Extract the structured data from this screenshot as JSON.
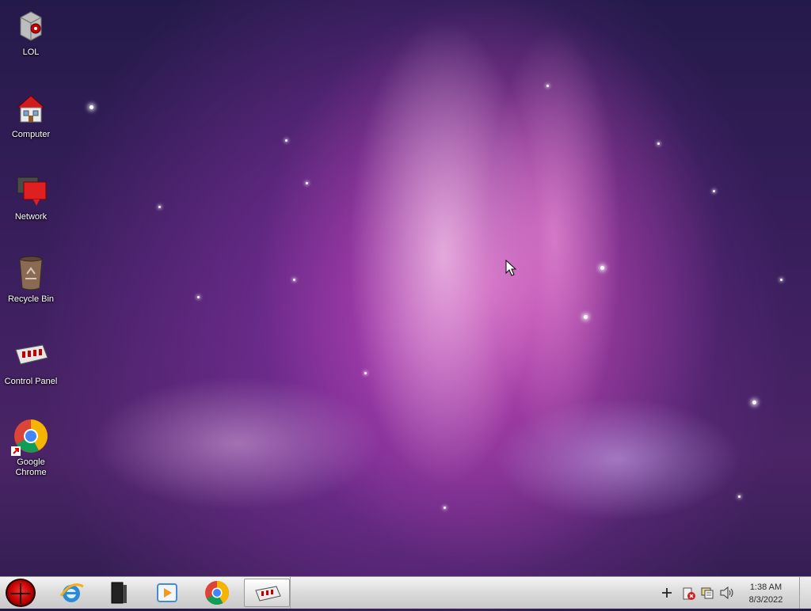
{
  "desktop": {
    "icons": [
      {
        "label": "LOL",
        "icon": "lol-app-icon"
      },
      {
        "label": "Computer",
        "icon": "computer-icon"
      },
      {
        "label": "Network",
        "icon": "network-icon"
      },
      {
        "label": "Recycle Bin",
        "icon": "recycle-bin-icon"
      },
      {
        "label": "Control Panel",
        "icon": "control-panel-icon"
      },
      {
        "label": "Google Chrome",
        "icon": "chrome-icon"
      }
    ]
  },
  "taskbar": {
    "start_icon": "start-orb-icon",
    "pinned": [
      {
        "icon": "internet-explorer-icon"
      },
      {
        "icon": "media-center-icon"
      },
      {
        "icon": "media-player-icon"
      },
      {
        "icon": "chrome-icon"
      },
      {
        "icon": "control-panel-icon",
        "active": true
      }
    ],
    "tray": {
      "icons": [
        "add-icon",
        "action-center-icon",
        "network-tray-icon",
        "volume-icon"
      ],
      "time": "1:38 AM",
      "date": "8/3/2022"
    }
  },
  "colors": {
    "accent_red": "#d80000",
    "taskbar": "#d6d6d6"
  }
}
